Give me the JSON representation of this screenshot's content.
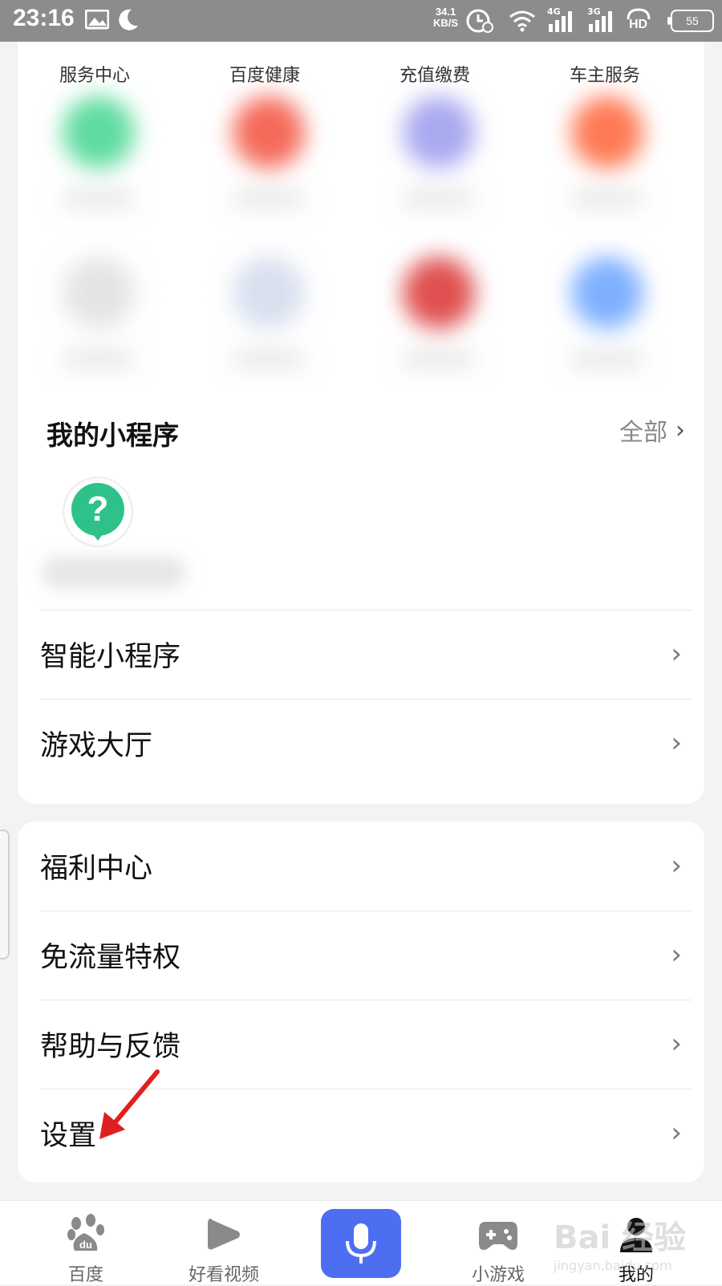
{
  "status_bar": {
    "time": "23:16",
    "speed_value": "34.1",
    "speed_unit": "KB/S",
    "signal_1": "4G",
    "signal_2": "3G",
    "hd": "HD",
    "battery": "55"
  },
  "services_row": {
    "labels": [
      "服务中心",
      "百度健康",
      "充值缴费",
      "车主服务"
    ]
  },
  "mini_programs": {
    "title": "我的小程序",
    "all_label": "全部",
    "chevron": "›"
  },
  "menu_group_1": {
    "items": [
      {
        "label": "智能小程序"
      },
      {
        "label": "游戏大厅"
      }
    ]
  },
  "menu_group_2": {
    "items": [
      {
        "label": "福利中心"
      },
      {
        "label": "免流量特权"
      },
      {
        "label": "帮助与反馈"
      },
      {
        "label": "设置"
      }
    ]
  },
  "chevron": "›",
  "bottom_nav": {
    "items": [
      {
        "label": "百度"
      },
      {
        "label": "好看视频"
      },
      {
        "label": "小游戏"
      },
      {
        "label": "我的"
      }
    ]
  },
  "watermark": {
    "text": "Bai 经验",
    "url": "jingyan.baidu.com"
  },
  "colors": {
    "accent": "#4e6ef2",
    "arrow": "#e02020",
    "miniprogram_icon": "#2ec28a"
  }
}
